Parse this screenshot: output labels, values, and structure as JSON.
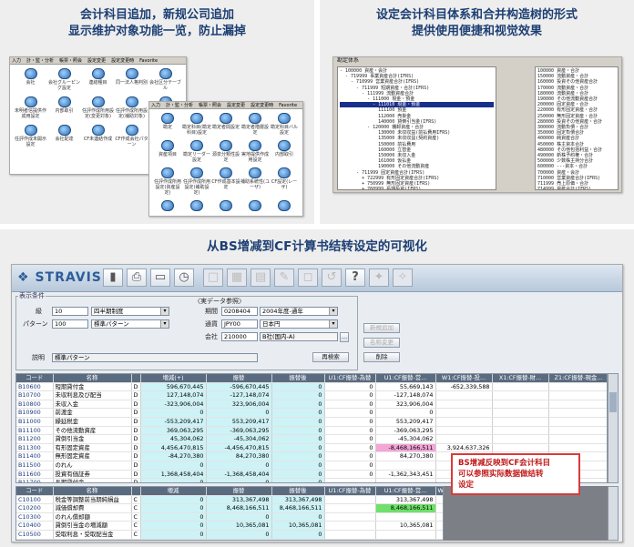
{
  "captions": {
    "top_left": [
      "会计科目追加，新规公司追加",
      "显示维护对象功能一览，防止漏掉"
    ],
    "top_right": [
      "设定会计科目体系和合并构造树的形式",
      "提供使用便捷和视觉效果"
    ],
    "bottom": "从BS增减到CF计算书结转设定的可视化"
  },
  "shot1": {
    "menu": [
      "入力",
      "計・監・分析",
      "帳票・照会",
      "設定変更",
      "設定変更時",
      "Favorite"
    ],
    "icons": [
      "会社",
      "会社グルーピング設定",
      "連結種目",
      "同一法人格判別",
      "会社区分テーブル",
      "未明者信提供作成用設定",
      "内部取引",
      "任評作成所用設定(変更対象)",
      "任評作成所用設定(補助対象)",
      "",
      "任評作成未開示設定",
      "会社配達",
      "CF未連結作成",
      "CF作成会社パターン",
      ""
    ]
  },
  "shot2": {
    "menu": [
      "入力",
      "計・監・分析",
      "帳票・照会",
      "設定変更",
      "設定変更時",
      "Favorite"
    ],
    "icons": [
      "勘定",
      "勘定科目(勘定科目)設定",
      "勘定者間設定",
      "勘定者階層設定",
      "勘定科目バル設定",
      "資産項目",
      "勘定リーダー設定",
      "源泉分類性設定",
      "実地提供作成用設定",
      "内部取引",
      "任評作成所用設定(資産設定)",
      "任評作成所用設定(補助設定)",
      "CF作成基本設定",
      "補助系統性(ユーザ)",
      "CF設定(レーザ)",
      "",
      "",
      "",
      "",
      ""
    ]
  },
  "shot3": {
    "title": "勘定体系",
    "tree": [
      "- 100000 資産・会計",
      "  - 719999 事業資産合計(IFRS)",
      "    - 710999 営業資産合計(IFRS)",
      "      - 711999 短期資産・合計(IFRS)",
      "        - 111999 流動資産合計",
      "          - 111000 現金・預金",
      "            - 111010 現金・預金",
      "              111100 預金",
      "              112000 売掛金",
      "              140000 貸倒引当金(IFRS)",
      "          - 120000 棚卸資産・合計",
      "              130000 未収収益(前払費用IFRS)",
      "              135000 未収収益(契約資産)",
      "              150000 前払費用",
      "              160000 立替金",
      "              150000 未収入金",
      "              161000 仮払金",
      "              190000 その他流動資産",
      "      - 711999 固定資産合計(IFRS)",
      "        + 722999 有形固定資産合計(IFRS)",
      "        + 750999 無形固定資産(IFRS)",
      "        + 760999 長期投資(IFRS)",
      "      + 780999 その他の固定資産(IFRS)",
      "  + 760000 負債・純資産合計(IFRS)"
    ],
    "list": [
      "100000 資産・合計",
      "150000 流動資産・合計",
      "160000 投資その他資産合計",
      "170000 流動資産・合計",
      "180000 流動資産・合計",
      "190000 その他流動資産合計",
      "200000 固定資産・合計",
      "220000 有形固定資産・合計",
      "250000 無形固定資産・合計",
      "280000 投資その他資産・合計",
      "300000 流動負債・合計",
      "350000 固定負債合計",
      "400000 純資産合計",
      "450000 株主資本合計",
      "480000 その他包括利益・合計",
      "490000 新株予約権・合計",
      "500000 少数株主持分合計",
      "600000 ---資本・合計",
      "700000 資産・会計",
      "710000 営業資産合計(IFRS)",
      "711999 売上原価・合計",
      "714999 資産合計(IFRS)",
      "740000 固定資産項目・合計",
      "750000 --有形固定・資産",
      "760000 (PLC非)フリー合計(IFRS)",
      "765000 --無形固定・資産",
      "770000 その他の固定資産(IFRS)",
      "780000 資産・合計(IFRS)",
      "790000 その他資産・合計(IFRS)",
      "800000 資本・合計(IFRS)"
    ]
  },
  "stravis": {
    "logo": "STRAVIS",
    "group_label": "表示条件",
    "ref_label": "〈実データ参照〉",
    "fields": {
      "kyu_label": "級",
      "kyu_value": "10",
      "kyu_select": "四半期制度",
      "pattern_label": "パターン",
      "pattern_value": "100",
      "pattern_select": "標準パターン",
      "period_label": "期間",
      "period_value": "0208404",
      "period_select": "2004年度-通年",
      "currency_label": "通貨",
      "currency_value": "JPY00",
      "currency_select": "日本円",
      "company_label": "会社",
      "company_value": "210000",
      "company_select": "B社(国内-A)",
      "desc_label": "説明",
      "desc_value": "標準パターン"
    },
    "buttons": {
      "new": "新規追加",
      "rename": "名称変更",
      "delete": "削除",
      "research": "再検索"
    },
    "top_table": {
      "headers": [
        "コード",
        "名称",
        "",
        "増減(+)",
        "振替",
        "振替後",
        "U1:CF振替-為替",
        "U1:CF振替-営...",
        "W1:CF振替-投...",
        "X1:CF振替-財...",
        "Z1:CF振替-現金..."
      ],
      "rows": [
        [
          "B10600",
          "短期貸付金",
          "D",
          "596,670,445",
          "-596,670,445",
          "0",
          "0",
          "55,669,143",
          "-652,339,588",
          "",
          ""
        ],
        [
          "B10700",
          "未収利息及び配当",
          "D",
          "127,148,074",
          "-127,148,074",
          "0",
          "0",
          "-127,148,074",
          "",
          "",
          ""
        ],
        [
          "B10800",
          "未収入金",
          "D",
          "-323,906,004",
          "323,906,004",
          "0",
          "0",
          "323,906,004",
          "",
          "",
          ""
        ],
        [
          "B10900",
          "前渡金",
          "D",
          "0",
          "0",
          "0",
          "0",
          "0",
          "",
          "",
          ""
        ],
        [
          "B11000",
          "繰延税金",
          "D",
          "-553,209,417",
          "553,209,417",
          "0",
          "0",
          "553,209,417",
          "",
          "",
          ""
        ],
        [
          "B11100",
          "その他流動資産",
          "D",
          "369,063,295",
          "-369,063,295",
          "0",
          "0",
          "-369,063,295",
          "",
          "",
          ""
        ],
        [
          "B11200",
          "貸倒引当金",
          "D",
          "45,304,062",
          "-45,304,062",
          "0",
          "0",
          "-45,304,062",
          "",
          "",
          ""
        ],
        [
          "B11300",
          "有形固定資産",
          "D",
          "4,456,470,815",
          "-4,456,470,815",
          "0",
          "0",
          "-8,468,166,511",
          "3,924,637,326",
          "",
          ""
        ],
        [
          "B11400",
          "無形固定資産",
          "D",
          "-84,270,380",
          "84,270,380",
          "0",
          "0",
          "84,270,380",
          "",
          "",
          ""
        ],
        [
          "B11500",
          "のれん",
          "D",
          "0",
          "0",
          "0",
          "0",
          "",
          "",
          "",
          ""
        ],
        [
          "B11600",
          "投資有価証券",
          "D",
          "1,368,458,404",
          "-1,368,458,404",
          "0",
          "0",
          "-1,362,343,451",
          "",
          "",
          ""
        ],
        [
          "B11700",
          "長期貸付金",
          "D",
          "0",
          "0",
          "0",
          "",
          "",
          "",
          "",
          ""
        ]
      ]
    },
    "bottom_table": {
      "headers": [
        "コード",
        "名称",
        "",
        "増減",
        "振替",
        "振替後",
        "U1:CF振替-為替",
        "U1:CF振替-営...",
        "W1:CF..."
      ],
      "rows": [
        [
          "C10100",
          "税金等調整前当期純損益",
          "C",
          "0",
          "313,367,498",
          "313,367,498",
          "",
          "313,367,498",
          ""
        ],
        [
          "C10200",
          "減価償却費",
          "C",
          "0",
          "8,468,166,511",
          "8,468,166,511",
          "",
          "8,468,166,511",
          ""
        ],
        [
          "C10300",
          "のれん償却額",
          "C",
          "0",
          "0",
          "0",
          "",
          "",
          ""
        ],
        [
          "C10400",
          "貸倒引当金の増減額",
          "C",
          "0",
          "10,365,081",
          "10,365,081",
          "",
          "10,365,081",
          ""
        ],
        [
          "C10500",
          "受取利息・受取配当金",
          "C",
          "0",
          "0",
          "0",
          "",
          "",
          ""
        ],
        [
          "C10600",
          "支払利息",
          "C",
          "0",
          "0",
          "0",
          "",
          "",
          ""
        ]
      ]
    },
    "callout": [
      "BS增减反映到CF会计科目",
      "可以参照实际数据做结转",
      "设定"
    ],
    "colors": {
      "highlight_pink": "#f4a6d8",
      "highlight_green": "#6fe06b",
      "callout_border": "#d93a3a"
    }
  }
}
